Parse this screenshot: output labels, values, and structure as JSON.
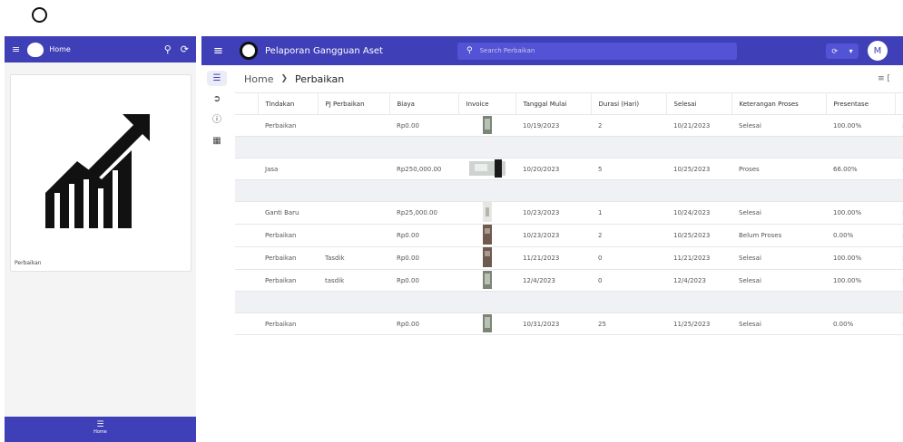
{
  "left": {
    "home_label": "Home",
    "card_label": "Perbaikan",
    "footer_label": "Home"
  },
  "app": {
    "title": "Pelaporan Gangguan Aset",
    "search_placeholder": "Search Perbaikan",
    "avatar_letter": "M"
  },
  "breadcrumb": {
    "home": "Home",
    "current": "Perbaikan"
  },
  "table": {
    "headers": [
      "Tindakan",
      "PJ Perbaikan",
      "Biaya",
      "Invoice",
      "Tanggal Mulai",
      "Durasi (Hari)",
      "Selesai",
      "Keterangan Proses",
      "Presentase"
    ],
    "rows": [
      {
        "blank": false,
        "tindakan": "Perbaikan",
        "pj": "",
        "biaya": "Rp0.00",
        "thumb": "tall",
        "mulai": "10/19/2023",
        "durasi": "2",
        "selesai": "10/21/2023",
        "ket": "Selesai",
        "pres": "100.00%"
      },
      {
        "blank": true
      },
      {
        "blank": false,
        "tindakan": "Jasa",
        "pj": "",
        "biaya": "Rp250,000.00",
        "thumb": "wide",
        "mulai": "10/20/2023",
        "durasi": "5",
        "selesai": "10/25/2023",
        "ket": "Proses",
        "pres": "66.00%"
      },
      {
        "blank": true
      },
      {
        "blank": false,
        "tindakan": "Ganti Baru",
        "pj": "",
        "biaya": "Rp25,000.00",
        "thumb": "light",
        "mulai": "10/23/2023",
        "durasi": "1",
        "selesai": "10/24/2023",
        "ket": "Selesai",
        "pres": "100.00%"
      },
      {
        "blank": false,
        "tindakan": "Perbaikan",
        "pj": "",
        "biaya": "Rp0.00",
        "thumb": "dark",
        "mulai": "10/23/2023",
        "durasi": "2",
        "selesai": "10/25/2023",
        "ket": "Belum Proses",
        "pres": "0.00%"
      },
      {
        "blank": false,
        "tindakan": "Perbaikan",
        "pj": "Tasdik",
        "biaya": "Rp0.00",
        "thumb": "dark",
        "mulai": "11/21/2023",
        "durasi": "0",
        "selesai": "11/21/2023",
        "ket": "Selesai",
        "pres": "100.00%"
      },
      {
        "blank": false,
        "tindakan": "Perbaikan",
        "pj": "tasdik",
        "biaya": "Rp0.00",
        "thumb": "tall",
        "mulai": "12/4/2023",
        "durasi": "0",
        "selesai": "12/4/2023",
        "ket": "Selesai",
        "pres": "100.00%"
      },
      {
        "blank": true
      },
      {
        "blank": false,
        "tindakan": "Perbaikan",
        "pj": "",
        "biaya": "Rp0.00",
        "thumb": "tall",
        "mulai": "10/31/2023",
        "durasi": "25",
        "selesai": "11/25/2023",
        "ket": "Selesai",
        "pres": "0.00%"
      }
    ]
  }
}
